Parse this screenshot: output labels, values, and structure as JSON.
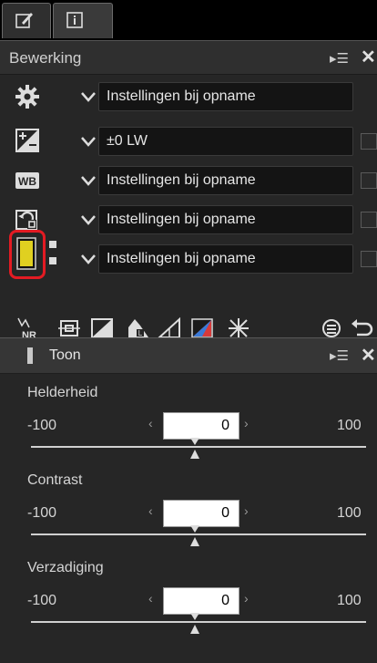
{
  "tabs": [
    {
      "icon": "edit-pencil-icon"
    },
    {
      "icon": "info-icon"
    }
  ],
  "edit_panel": {
    "title": "Bewerking",
    "rows": [
      {
        "icon": "gear-icon",
        "value": "Instellingen bij opname",
        "has_checkbox": false
      },
      {
        "icon": "exposure-compensation-icon",
        "value": "±0 LW",
        "has_checkbox": true
      },
      {
        "icon": "white-balance-icon",
        "value": "Instellingen bij opname",
        "has_checkbox": true
      },
      {
        "icon": "picture-control-icon",
        "value": "Instellingen bij opname",
        "has_checkbox": true
      },
      {
        "icon": "tone-level-icon",
        "value": "Instellingen bij opname",
        "has_checkbox": true,
        "highlighted": true
      }
    ],
    "toolbar": [
      "noise-reduction-icon",
      "crop-icon",
      "levels-icon",
      "lch-icon",
      "straighten-icon",
      "color-balance-icon",
      "retouch-brush-icon",
      "reset-icon",
      "undo-icon"
    ]
  },
  "toon_panel": {
    "title": "Toon",
    "sliders": [
      {
        "label": "Helderheid",
        "min": "-100",
        "max": "100",
        "value": "0",
        "position": 0.5
      },
      {
        "label": "Contrast",
        "min": "-100",
        "max": "100",
        "value": "0",
        "position": 0.5
      },
      {
        "label": "Verzadiging",
        "min": "-100",
        "max": "100",
        "value": "0",
        "position": 0.5
      }
    ]
  },
  "colors": {
    "highlight": "#e31b23",
    "tone_swatch": "#e0d020"
  }
}
